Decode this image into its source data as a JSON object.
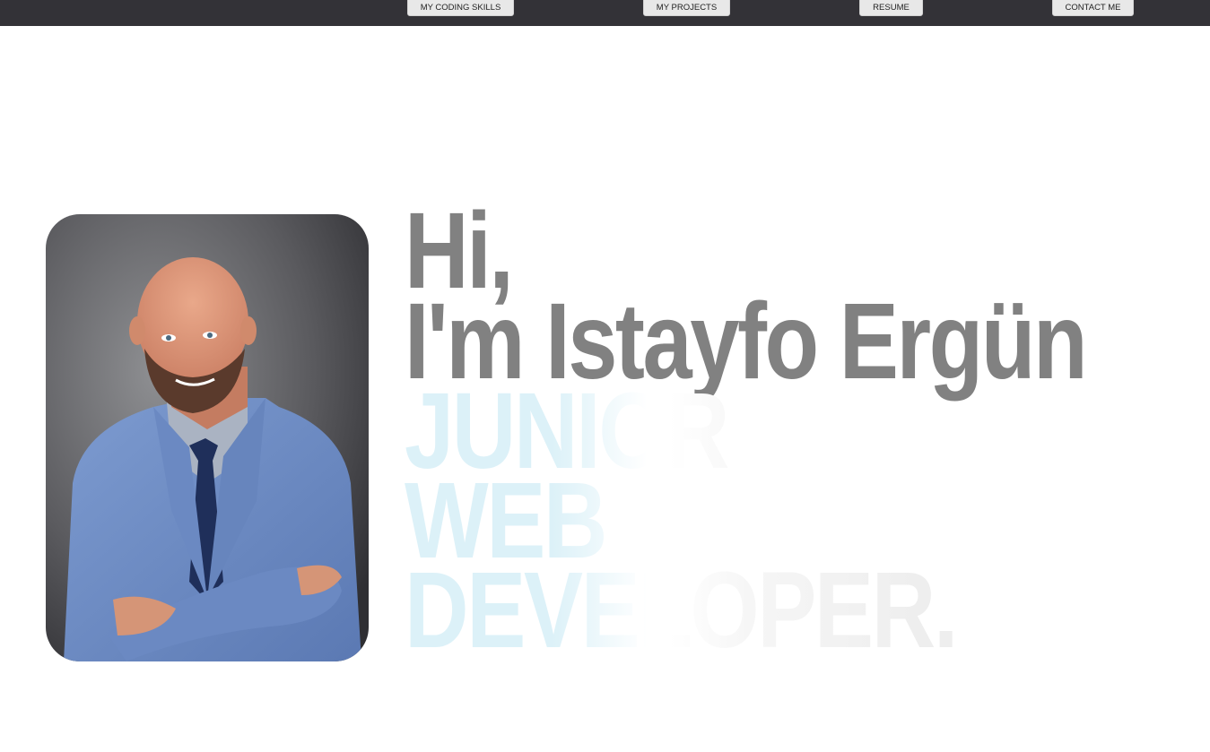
{
  "nav": {
    "items": [
      {
        "label": "MY CODING SKILLS"
      },
      {
        "label": "MY PROJECTS"
      },
      {
        "label": "RESUME"
      },
      {
        "label": "CONTACT ME"
      }
    ]
  },
  "hero": {
    "greeting": "Hi,",
    "name_line": "I'm Istayfo Ergün",
    "role_lines": [
      "JUNIOR",
      "WEB",
      "DEVELOPER."
    ],
    "photo_icon": "portrait-photo"
  },
  "colors": {
    "navbar": "#333237",
    "nav_button": "#e8e8e8",
    "headline": "#818181",
    "role_fade_start": "#dcf1f8",
    "role_fade_end": "#eeeeee"
  }
}
